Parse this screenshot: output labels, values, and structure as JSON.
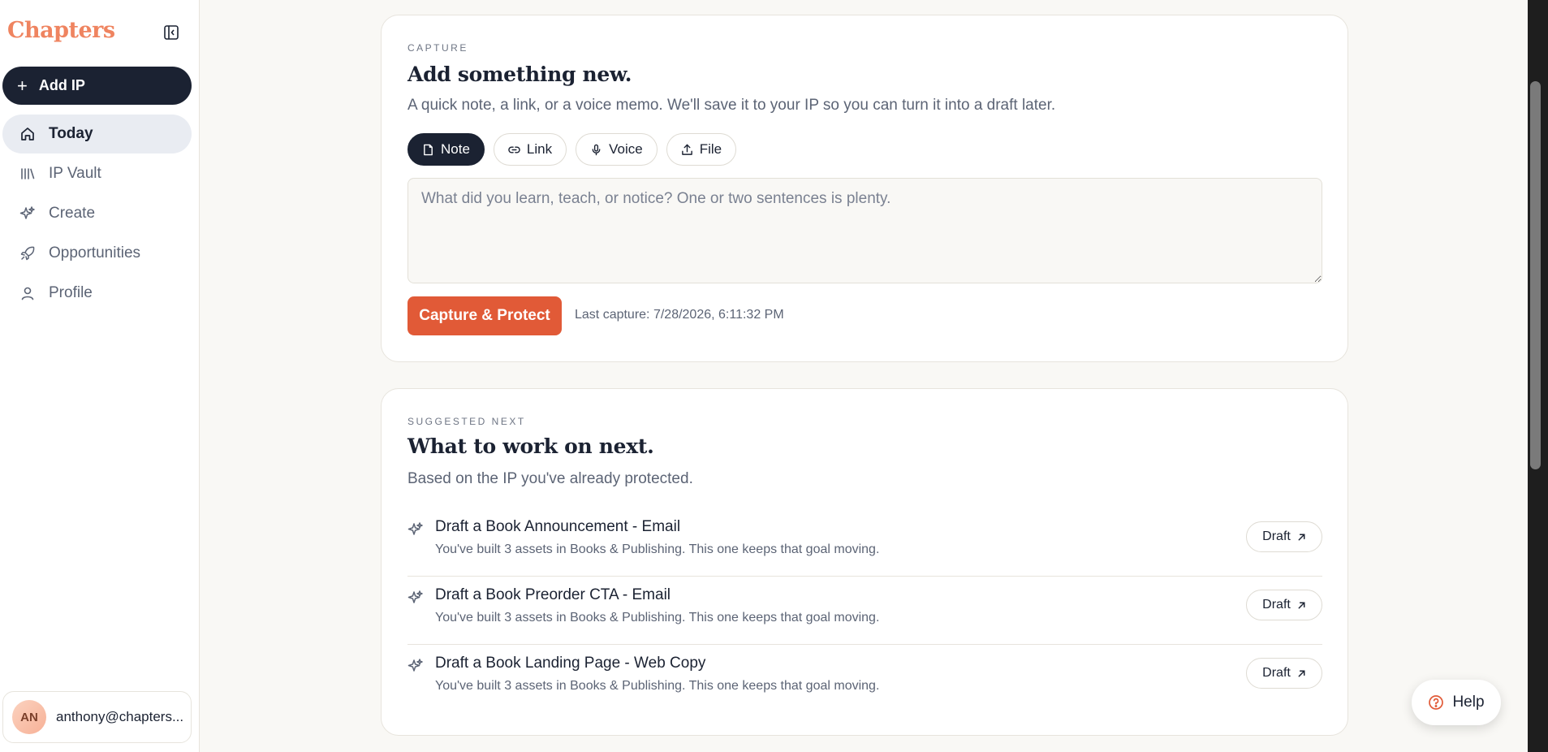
{
  "app": {
    "brand": "Chapters"
  },
  "sidebar": {
    "add_label": "Add IP",
    "items": [
      {
        "label": "Today",
        "icon": "home-icon",
        "active": true
      },
      {
        "label": "IP Vault",
        "icon": "library-icon",
        "active": false
      },
      {
        "label": "Create",
        "icon": "sparkles-icon",
        "active": false
      },
      {
        "label": "Opportunities",
        "icon": "rocket-icon",
        "active": false
      },
      {
        "label": "Profile",
        "icon": "user-icon",
        "active": false
      }
    ],
    "user": {
      "initials": "AN",
      "email": "anthony@chapters..."
    }
  },
  "capture": {
    "eyebrow": "CAPTURE",
    "title": "Add something new.",
    "subtitle": "A quick note, a link, or a voice memo. We'll save it to your IP so you can turn it into a draft later.",
    "modes": [
      "Note",
      "Link",
      "Voice",
      "File"
    ],
    "active_mode": "Note",
    "input_placeholder": "What did you learn, teach, or notice? One or two sentences is plenty.",
    "button_label": "Capture & Protect",
    "last_capture": "Last capture: 7/28/2026, 6:11:32 PM"
  },
  "suggested": {
    "eyebrow": "SUGGESTED NEXT",
    "title": "What to work on next.",
    "subtitle": "Based on the IP you've already protected.",
    "items": [
      {
        "title": "Draft a Book Announcement - Email",
        "desc": "You've built 3 assets in Books & Publishing. This one keeps that goal moving.",
        "action": "Draft"
      },
      {
        "title": "Draft a Book Preorder CTA - Email",
        "desc": "You've built 3 assets in Books & Publishing. This one keeps that goal moving.",
        "action": "Draft"
      },
      {
        "title": "Draft a Book Landing Page - Web Copy",
        "desc": "You've built 3 assets in Books & Publishing. This one keeps that goal moving.",
        "action": "Draft"
      }
    ]
  },
  "help_label": "Help",
  "colors": {
    "brand": "#ef8460",
    "primary_dark": "#1b2232",
    "accent": "#e15a37",
    "background": "#f9f8f5"
  }
}
